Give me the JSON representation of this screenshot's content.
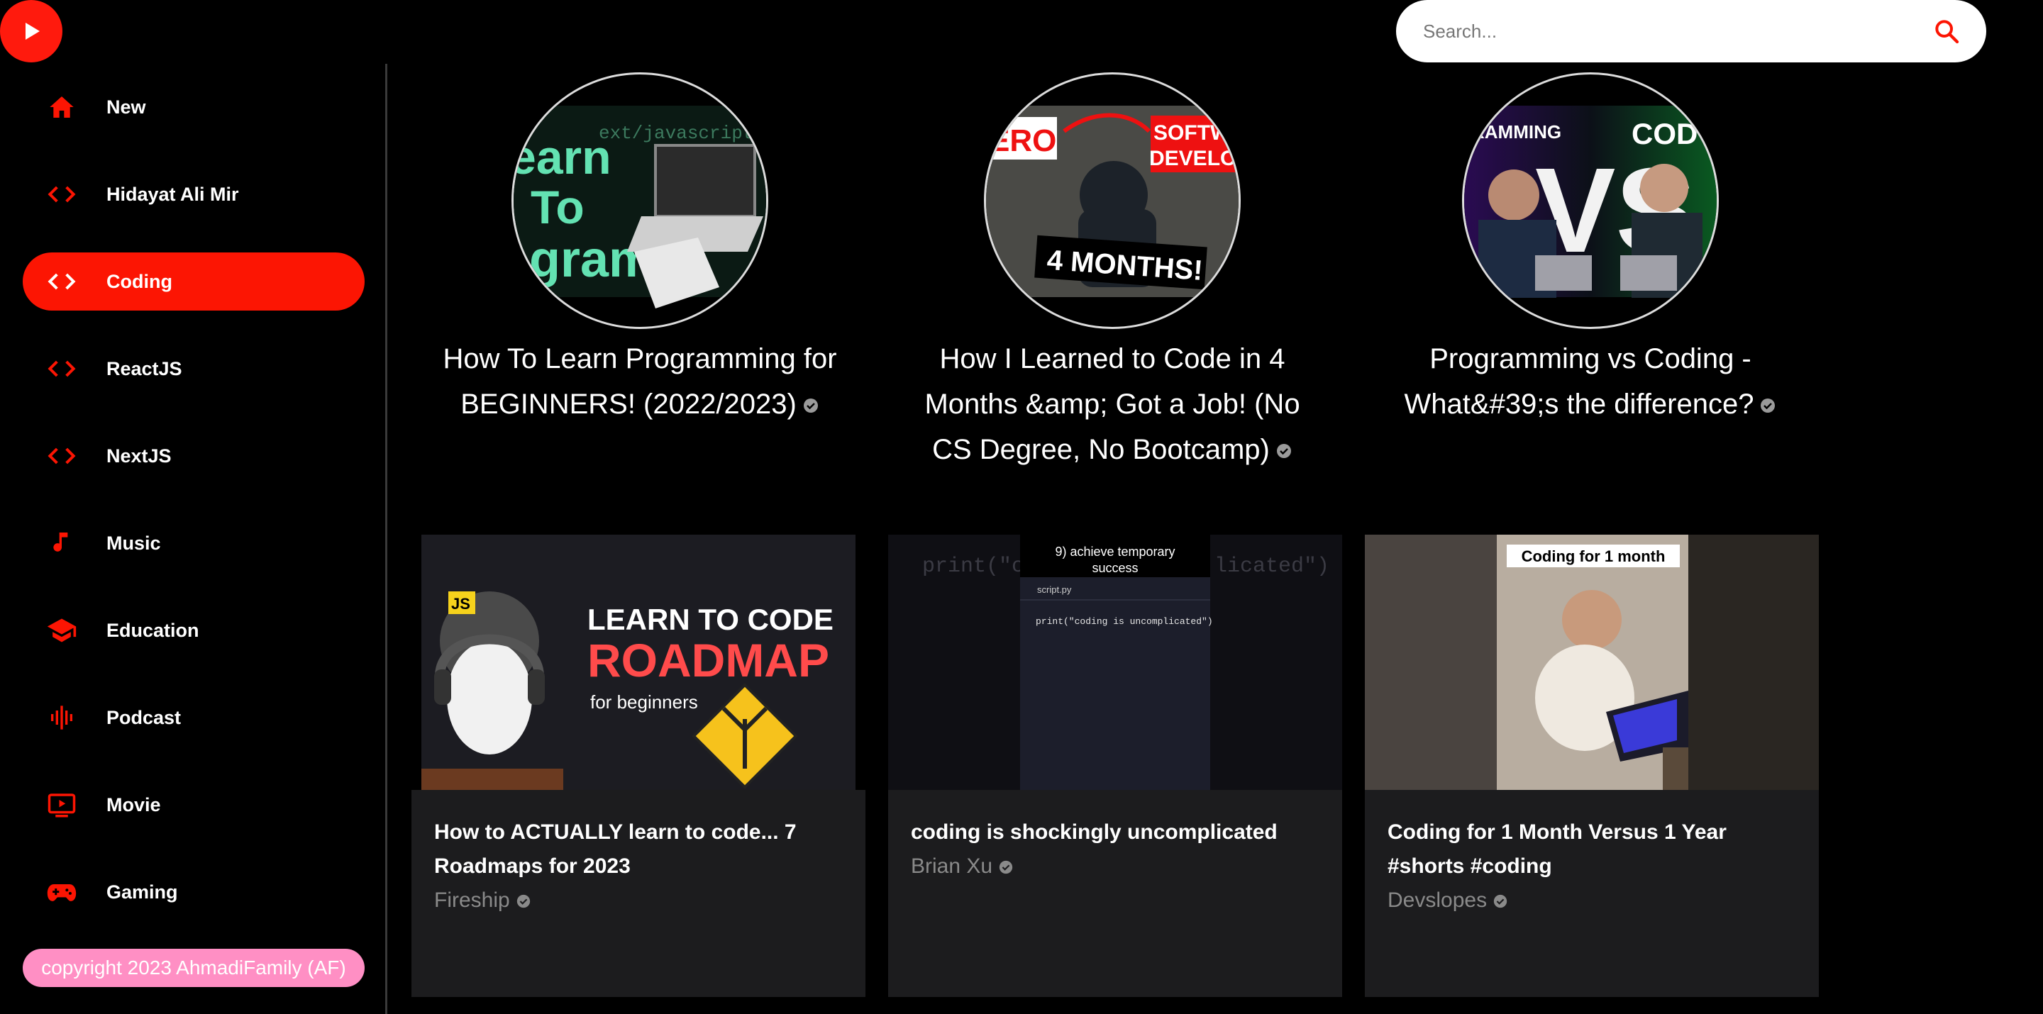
{
  "search": {
    "placeholder": "Search..."
  },
  "sidebar": {
    "items": [
      {
        "label": "New",
        "icon": "home-icon"
      },
      {
        "label": "Hidayat Ali Mir",
        "icon": "code-icon"
      },
      {
        "label": "Coding",
        "icon": "code-icon",
        "active": true
      },
      {
        "label": "ReactJS",
        "icon": "code-icon"
      },
      {
        "label": "NextJS",
        "icon": "code-icon"
      },
      {
        "label": "Music",
        "icon": "music-note-icon"
      },
      {
        "label": "Education",
        "icon": "graduation-cap-icon"
      },
      {
        "label": "Podcast",
        "icon": "podcast-icon"
      },
      {
        "label": "Movie",
        "icon": "ondemand-video-icon"
      },
      {
        "label": "Gaming",
        "icon": "gamepad-icon"
      }
    ],
    "copyright": "copyright 2023 AhmadiFamily (AF)"
  },
  "channels": [
    {
      "title": "How To Learn Programming for BEGINNERS! (2022/2023)",
      "thumb_text": [
        "earn",
        "To",
        "ogram",
        "ext/javascript"
      ]
    },
    {
      "title": "How I Learned to Code in 4 Months &amp; Got a Job! (No CS Degree, No Bootcamp)",
      "thumb_text": [
        "ERO",
        "SOFTW",
        "DEVELO",
        "4 MONTHS!"
      ]
    },
    {
      "title": "Programming vs Coding - What&#39;s the difference?",
      "thumb_text": [
        "RAMMING",
        "COD",
        "VS"
      ]
    }
  ],
  "videos": [
    {
      "title": "How to ACTUALLY learn to code... 7 Roadmaps for 2023",
      "channel": "Fireship",
      "thumb_text": [
        "LEARN TO CODE",
        "ROADMAP",
        "for beginners",
        "JS"
      ]
    },
    {
      "title": "coding is shockingly uncomplicated",
      "channel": "Brian Xu",
      "thumb_text": [
        "9) achieve temporary",
        "success",
        "script.py",
        "print(\"coding is uncomplicated\")",
        "print(\"c",
        "licated\")"
      ]
    },
    {
      "title": "Coding for 1 Month Versus 1 Year #shorts #coding",
      "channel": "Devslopes",
      "thumb_text": [
        "Coding for 1 month"
      ]
    }
  ],
  "colors": {
    "accent": "#fc1503",
    "copyright_bg": "#ff8fc4",
    "card_bg": "#1c1c1e",
    "muted": "#8a8a8a"
  }
}
